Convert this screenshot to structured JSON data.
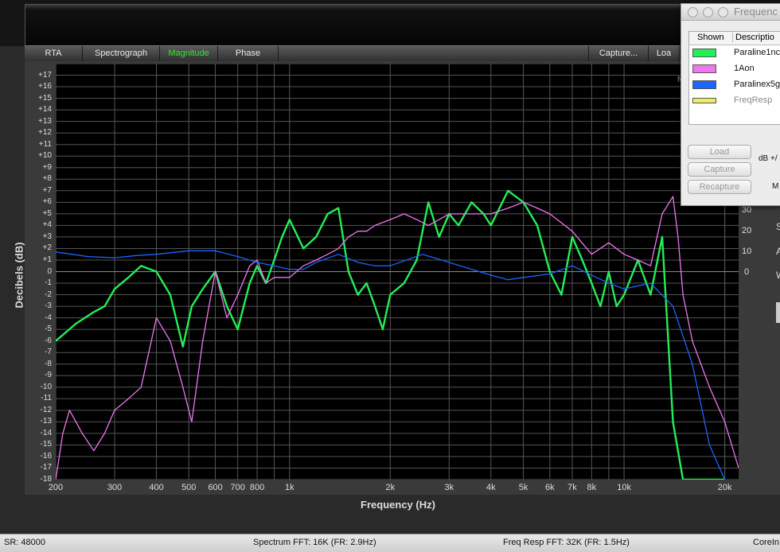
{
  "tabs": [
    "RTA",
    "Spectrograph",
    "Magnitude",
    "Phase"
  ],
  "active_tab": "Magnitude",
  "right_tabs": [
    "Capture...",
    "Loa"
  ],
  "plot_corner_label": "M",
  "status": {
    "sr": "SR: 48000",
    "spectrum": "Spectrum FFT: 16K (FR: 2.9Hz)",
    "freqresp": "Freq Resp FFT: 32K (FR: 1.5Hz)",
    "right": "CoreIn"
  },
  "window": {
    "title": "Frequenc",
    "col_shown": "Shown",
    "col_desc": "Descriptio",
    "rows": [
      {
        "desc": "Paraline1nc",
        "color": "#22ee55"
      },
      {
        "desc": "1Aon",
        "color": "#ee77ee"
      },
      {
        "desc": "Paralinex5g",
        "color": "#1a66ff"
      },
      {
        "desc": "FreqResp",
        "color": "#eeee66"
      }
    ],
    "buttons": [
      "Load",
      "Capture",
      "Recapture"
    ],
    "db_label": "dB +/",
    "m_label": "M"
  },
  "right_side_letters": [
    "S",
    "A",
    "W"
  ],
  "secondary_scale": [
    "30",
    "20",
    "10",
    "0"
  ],
  "chart_data": {
    "type": "line",
    "xlabel": "Frequency (Hz)",
    "ylabel": "Decibels (dB)",
    "x_scale": "log",
    "xlim": [
      200,
      22000
    ],
    "ylim": [
      -18,
      18
    ],
    "x_ticks": [
      200,
      300,
      400,
      500,
      600,
      700,
      800,
      1000,
      2000,
      3000,
      4000,
      5000,
      6000,
      7000,
      8000,
      10000,
      20000
    ],
    "x_tick_labels": [
      "200",
      "300",
      "400",
      "500",
      "600",
      "700",
      "800",
      "1k",
      "2k",
      "3k",
      "4k",
      "5k",
      "6k",
      "7k",
      "8k",
      "10k",
      "20k"
    ],
    "y_tick_labels": [
      "+17",
      "+16",
      "+15",
      "+14",
      "+13",
      "+12",
      "+11",
      "+10",
      "+9",
      "+8",
      "+7",
      "+6",
      "+5",
      "+4",
      "+3",
      "+2",
      "+1",
      "0",
      "-1",
      "-2",
      "-3",
      "-4",
      "-5",
      "-6",
      "-7",
      "-8",
      "-9",
      "-10",
      "-11",
      "-12",
      "-13",
      "-14",
      "-15",
      "-16",
      "-17",
      "-18"
    ],
    "series": [
      {
        "name": "Paraline1nc",
        "color": "#22ee55",
        "x": [
          200,
          230,
          260,
          280,
          300,
          330,
          360,
          400,
          440,
          480,
          510,
          550,
          600,
          650,
          700,
          760,
          800,
          850,
          900,
          950,
          1000,
          1100,
          1200,
          1300,
          1400,
          1500,
          1600,
          1700,
          1800,
          1900,
          2000,
          2200,
          2400,
          2600,
          2800,
          3000,
          3200,
          3500,
          3800,
          4000,
          4500,
          5000,
          5500,
          6000,
          6500,
          7000,
          7500,
          8000,
          8500,
          9000,
          9500,
          10000,
          11000,
          12000,
          13000,
          14000,
          15000,
          16000,
          20000
        ],
        "y": [
          -6,
          -4.5,
          -3.5,
          -3,
          -1.5,
          -0.5,
          0.5,
          0,
          -2,
          -6.5,
          -3,
          -1.5,
          0,
          -3,
          -5,
          -1,
          0.5,
          -1,
          1,
          3,
          4.5,
          2,
          3,
          5,
          5.5,
          0,
          -2,
          -1,
          -3,
          -5,
          -2,
          -1,
          1,
          6,
          3,
          5,
          4,
          6,
          5,
          4,
          7,
          6,
          4,
          0,
          -2,
          3,
          1,
          -1,
          -3,
          0,
          -3,
          -2,
          1,
          -2,
          3,
          -13,
          -18,
          -18,
          -18
        ]
      },
      {
        "name": "1Aon",
        "color": "#ee77ee",
        "x": [
          200,
          210,
          220,
          240,
          260,
          280,
          300,
          330,
          360,
          400,
          440,
          480,
          510,
          550,
          600,
          650,
          700,
          760,
          800,
          850,
          900,
          1000,
          1100,
          1200,
          1300,
          1400,
          1500,
          1600,
          1700,
          1800,
          2000,
          2200,
          2400,
          2600,
          2800,
          3000,
          3500,
          4000,
          4500,
          5000,
          5500,
          6000,
          7000,
          8000,
          9000,
          10000,
          11000,
          12000,
          13000,
          14000,
          14500,
          15000,
          16000,
          18000,
          20000,
          22000
        ],
        "y": [
          -18,
          -14,
          -12,
          -14,
          -15.5,
          -14,
          -12,
          -11,
          -10,
          -4,
          -6,
          -10,
          -13,
          -6,
          0,
          -4,
          -2,
          0.5,
          1,
          -1,
          -0.5,
          -0.5,
          0.5,
          1,
          1.5,
          2,
          3,
          3.5,
          3.5,
          4,
          4.5,
          5,
          4.5,
          4,
          4.5,
          5,
          5,
          5,
          5.5,
          6,
          5.5,
          5,
          3.5,
          1.5,
          2.5,
          1.5,
          1,
          0.5,
          5,
          6.5,
          3,
          -2,
          -6,
          -10,
          -13,
          -17
        ]
      },
      {
        "name": "Paralinex5g",
        "color": "#1a66ff",
        "x": [
          200,
          250,
          300,
          350,
          400,
          500,
          600,
          700,
          800,
          900,
          1000,
          1100,
          1200,
          1400,
          1600,
          1800,
          2000,
          2500,
          3000,
          3500,
          4000,
          4500,
          5000,
          6000,
          7000,
          8000,
          9000,
          10000,
          12000,
          14000,
          16000,
          18000,
          20000
        ],
        "y": [
          1.7,
          1.3,
          1.2,
          1.4,
          1.5,
          1.8,
          1.8,
          1.3,
          0.8,
          0.5,
          0.2,
          0.2,
          0.8,
          1.5,
          0.8,
          0.5,
          0.5,
          1.5,
          0.8,
          0.2,
          -0.3,
          -0.7,
          -0.5,
          -0.2,
          0.5,
          -0.3,
          -1,
          -1.5,
          -1,
          -3,
          -8,
          -15,
          -18
        ]
      },
      {
        "name": "FreqResp",
        "color": "#eeee66",
        "x": [],
        "y": []
      }
    ]
  }
}
